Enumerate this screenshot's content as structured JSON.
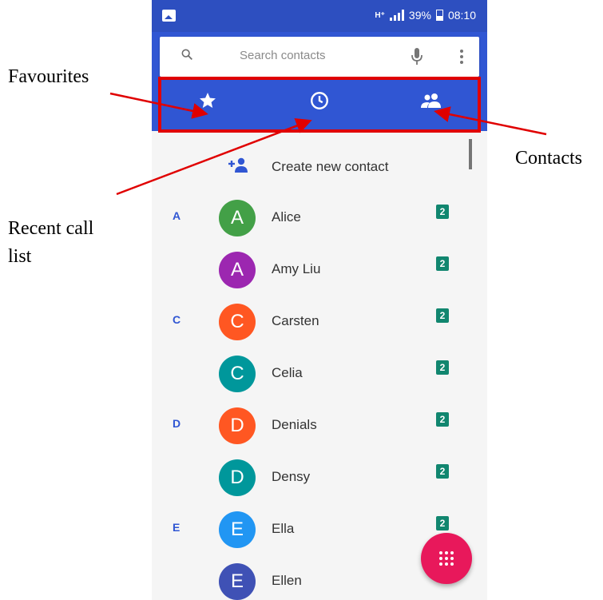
{
  "status_bar": {
    "network": "H⁺",
    "battery": "39%",
    "time": "08:10"
  },
  "search": {
    "placeholder": "Search contacts"
  },
  "tabs": [
    {
      "id": "favourites",
      "icon": "star-icon"
    },
    {
      "id": "recents",
      "icon": "clock-icon"
    },
    {
      "id": "contacts",
      "icon": "people-icon"
    }
  ],
  "create_contact": {
    "label": "Create new contact",
    "icon": "add-person-icon"
  },
  "contacts": [
    {
      "letter": "A",
      "initial": "A",
      "name": "Alice",
      "color": "#43a047",
      "sim": "2"
    },
    {
      "letter": "",
      "initial": "A",
      "name": "Amy Liu",
      "color": "#9c27b0",
      "sim": "2"
    },
    {
      "letter": "C",
      "initial": "C",
      "name": "Carsten",
      "color": "#ff5722",
      "sim": "2"
    },
    {
      "letter": "",
      "initial": "C",
      "name": "Celia",
      "color": "#00979b",
      "sim": "2"
    },
    {
      "letter": "D",
      "initial": "D",
      "name": "Denials",
      "color": "#ff5722",
      "sim": "2"
    },
    {
      "letter": "",
      "initial": "D",
      "name": "Densy",
      "color": "#00979b",
      "sim": "2"
    },
    {
      "letter": "E",
      "initial": "E",
      "name": "Ella",
      "color": "#2196f3",
      "sim": "2"
    },
    {
      "letter": "",
      "initial": "E",
      "name": "Ellen",
      "color": "#3f51b5",
      "sim": ""
    }
  ],
  "annotations": {
    "favourites": "Favourites",
    "recent_line1": "Recent call",
    "recent_line2": "list",
    "contacts": "Contacts"
  },
  "colors": {
    "primary": "#3056d3",
    "status_bar": "#2d4fc0",
    "fab": "#e8185b",
    "highlight": "#e00000"
  }
}
